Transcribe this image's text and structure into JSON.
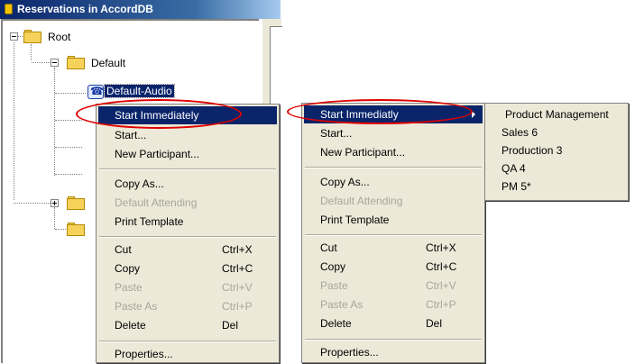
{
  "window": {
    "title": "Reservations in AccordDB"
  },
  "tree": {
    "root": "Root",
    "default": "Default",
    "selected_item": "Default-Audio"
  },
  "context_menu_left": {
    "items": [
      {
        "label": "Start Immediately",
        "shortcut": "",
        "state": "highlighted"
      },
      {
        "label": "Start...",
        "shortcut": "",
        "state": "enabled"
      },
      {
        "label": "New Participant...",
        "shortcut": "",
        "state": "enabled"
      },
      {
        "label": "Copy As...",
        "shortcut": "",
        "state": "enabled"
      },
      {
        "label": "Default Attending",
        "shortcut": "",
        "state": "disabled"
      },
      {
        "label": "Print Template",
        "shortcut": "",
        "state": "enabled"
      },
      {
        "label": "Cut",
        "shortcut": "Ctrl+X",
        "state": "enabled"
      },
      {
        "label": "Copy",
        "shortcut": "Ctrl+C",
        "state": "enabled"
      },
      {
        "label": "Paste",
        "shortcut": "Ctrl+V",
        "state": "disabled"
      },
      {
        "label": "Paste As",
        "shortcut": "Ctrl+P",
        "state": "disabled"
      },
      {
        "label": "Delete",
        "shortcut": "Del",
        "state": "enabled"
      },
      {
        "label": "Properties...",
        "shortcut": "",
        "state": "enabled"
      }
    ]
  },
  "context_menu_right": {
    "items": [
      {
        "label": "Start Immediatly",
        "shortcut": "",
        "state": "highlighted"
      },
      {
        "label": "Start...",
        "shortcut": "",
        "state": "enabled"
      },
      {
        "label": "New Participant...",
        "shortcut": "",
        "state": "enabled"
      },
      {
        "label": "Copy As...",
        "shortcut": "",
        "state": "enabled"
      },
      {
        "label": "Default Attending",
        "shortcut": "",
        "state": "disabled"
      },
      {
        "label": "Print Template",
        "shortcut": "",
        "state": "enabled"
      },
      {
        "label": "Cut",
        "shortcut": "Ctrl+X",
        "state": "enabled"
      },
      {
        "label": "Copy",
        "shortcut": "Ctrl+C",
        "state": "enabled"
      },
      {
        "label": "Paste",
        "shortcut": "Ctrl+V",
        "state": "disabled"
      },
      {
        "label": "Paste As",
        "shortcut": "Ctrl+P",
        "state": "disabled"
      },
      {
        "label": "Delete",
        "shortcut": "Del",
        "state": "enabled"
      },
      {
        "label": "Properties...",
        "shortcut": "",
        "state": "enabled"
      }
    ]
  },
  "submenu": {
    "items": [
      "Product Management",
      "Sales 6",
      "Production 3",
      "QA 4",
      "PM 5*"
    ]
  },
  "colors": {
    "highlight": "#0a246a",
    "menu_bg": "#ece9d8",
    "disabled_text": "#a7a69c",
    "annotation_ring": "#e00000",
    "folder": "#f6d25a"
  },
  "icons": {
    "title": "database-icon",
    "folder": "folder-icon",
    "item": "phone-icon",
    "expand": "plus-box-icon",
    "collapse": "minus-box-icon",
    "submenu": "triangle-right-icon"
  }
}
